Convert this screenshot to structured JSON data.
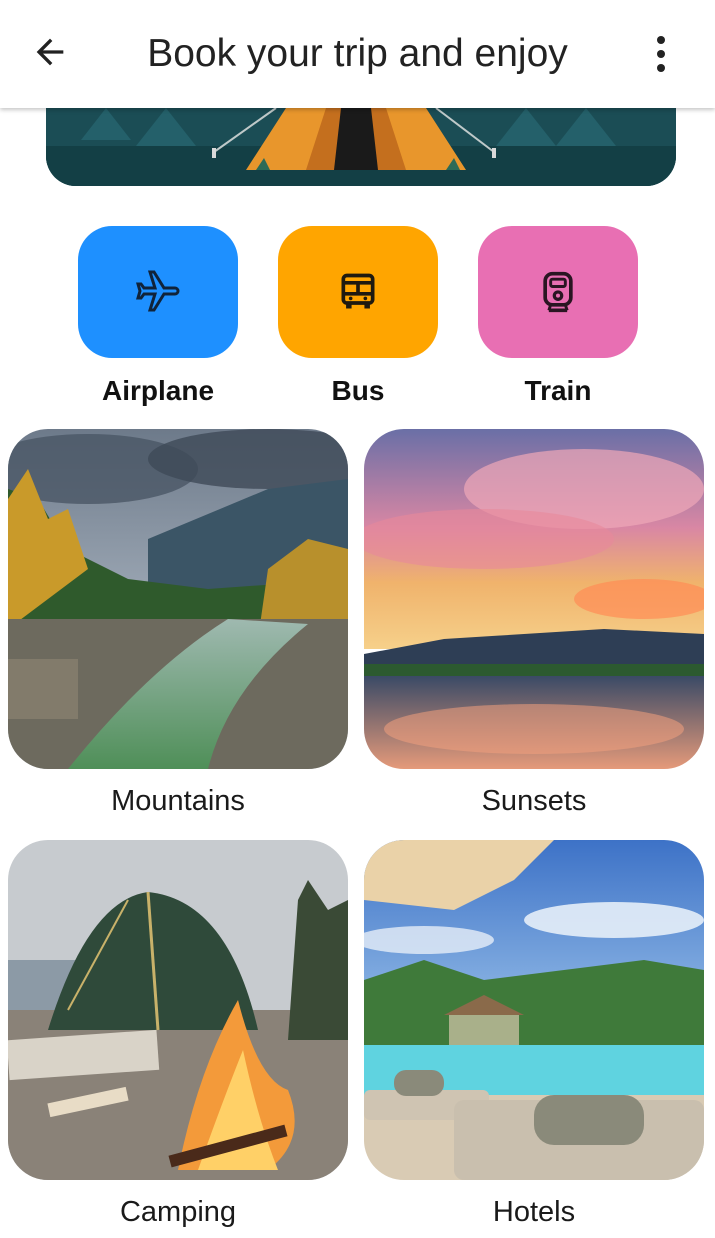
{
  "header": {
    "title": "Book your trip and enjoy",
    "back_icon": "arrow-back-icon",
    "menu_icon": "more-vert-icon"
  },
  "banner": {
    "illustration": "camping-tent-illustration"
  },
  "transport": [
    {
      "label": "Airplane",
      "icon": "airplane-icon",
      "color": "#1E90FF"
    },
    {
      "label": "Bus",
      "icon": "bus-icon",
      "color": "#FFA500"
    },
    {
      "label": "Train",
      "icon": "train-icon",
      "color": "#E86FB3"
    }
  ],
  "destinations": [
    {
      "label": "Mountains"
    },
    {
      "label": "Sunsets"
    },
    {
      "label": "Camping"
    },
    {
      "label": "Hotels"
    }
  ]
}
